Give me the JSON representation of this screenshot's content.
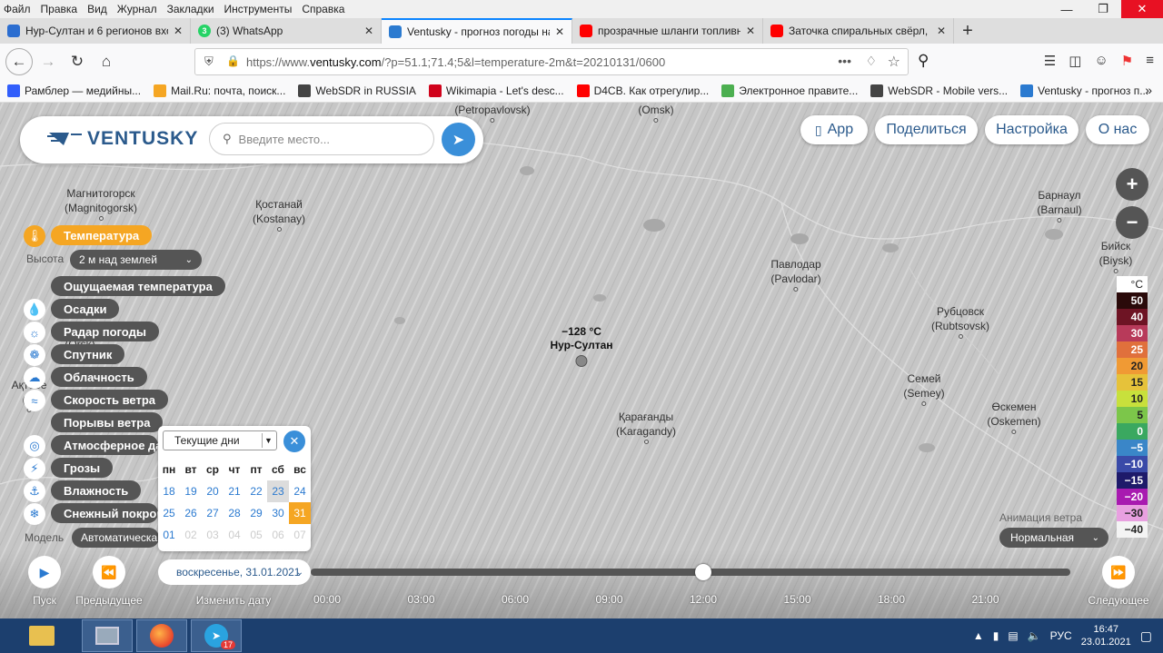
{
  "menu": [
    "Файл",
    "Правка",
    "Вид",
    "Журнал",
    "Закладки",
    "Инструменты",
    "Справка"
  ],
  "tabs": [
    {
      "title": "Нур-Султан и 6 регионов вхо",
      "icon": "at-icon",
      "color": "#2b6dd0"
    },
    {
      "title": "(3) WhatsApp",
      "icon": "whatsapp-icon",
      "color": "#25d366",
      "badge": "3"
    },
    {
      "title": "Ventusky - прогноз погоды на",
      "icon": "ventusky-icon",
      "color": "#2b7ad0"
    },
    {
      "title": "прозрачные шланги топливн",
      "icon": "youtube-icon",
      "color": "#ff0000"
    },
    {
      "title": "Заточка спиральных свёрл, в",
      "icon": "youtube-icon",
      "color": "#ff0000"
    }
  ],
  "url": {
    "prefix": "https://www.",
    "domain": "ventusky.com",
    "path": "/?p=51.1;71.4;5&l=temperature-2m&t=20210131/0600"
  },
  "bookmarks": [
    {
      "title": "Рамблер — медийны...",
      "icon": "rambler-icon",
      "color": "#315efb"
    },
    {
      "title": "Mail.Ru: почта, поиск...",
      "icon": "mailru-icon",
      "color": "#f5a623"
    },
    {
      "title": "WebSDR in RUSSIA",
      "icon": "globe-icon",
      "color": "#444"
    },
    {
      "title": "Wikimapia - Let's desc...",
      "icon": "wikimapia-icon",
      "color": "#d0021b"
    },
    {
      "title": "D4CB. Как отрегулир...",
      "icon": "youtube-icon",
      "color": "#ff0000"
    },
    {
      "title": "Электронное правите...",
      "icon": "egov-icon",
      "color": "#4caf50"
    },
    {
      "title": "WebSDR - Mobile vers...",
      "icon": "globe-icon",
      "color": "#444"
    },
    {
      "title": "Ventusky - прогноз п...",
      "icon": "ventusky-icon",
      "color": "#2b7ad0"
    }
  ],
  "app": {
    "logo": "VENTUSKY",
    "search_placeholder": "Введите место...",
    "top_buttons": [
      "App",
      "Поделиться",
      "Настройка",
      "О нас"
    ]
  },
  "cities": [
    {
      "name": "(Petropavlovsk)"
    },
    {
      "name": "(Omsk)"
    },
    {
      "name": "Магнитогорск",
      "sub": "(Magnitogorsk)"
    },
    {
      "name": "Қостанай",
      "sub": "(Kostanay)"
    },
    {
      "name": "Барнаул",
      "sub": "(Barnaul)"
    },
    {
      "name": "Бийск",
      "sub": "(Biysk)"
    },
    {
      "name": "Павлодар",
      "sub": "(Pavlodar)"
    },
    {
      "name": "Рубцовск",
      "sub": "(Rubtsovsk)"
    },
    {
      "name": "Семей",
      "sub": "(Semey)"
    },
    {
      "name": "Өскемен",
      "sub": "(Oskemen)"
    },
    {
      "name": "Қарағанды",
      "sub": "(Karagandy)"
    },
    {
      "name": "Орск",
      "sub": "(Orsk)"
    },
    {
      "name": "Ақтөбе",
      "sub": "(Al"
    }
  ],
  "selected_point": {
    "temp": "−128 °C",
    "name": "Нур-Султан"
  },
  "layers": {
    "temperature": "Температура",
    "height_label": "Высота",
    "height_value": "2 м над землей",
    "feels": "Ощущаемая температура",
    "precip": "Осадки",
    "radar": "Радар погоды",
    "satellite": "Спутник",
    "clouds": "Облачность",
    "wind": "Скорость ветра",
    "gusts": "Порывы ветра",
    "pressure": "Атмосферное да",
    "storms": "Грозы",
    "humidity": "Влажность",
    "snow": "Снежный покров",
    "model_label": "Модель",
    "model_value": "Автоматическа"
  },
  "calendar": {
    "range": "Текущие дни",
    "weekdays": [
      "пн",
      "вт",
      "ср",
      "чт",
      "пт",
      "сб",
      "вс"
    ],
    "weeks": [
      [
        "18",
        "19",
        "20",
        "21",
        "22",
        "23",
        "24"
      ],
      [
        "25",
        "26",
        "27",
        "28",
        "29",
        "30",
        "31"
      ],
      [
        "01",
        "02",
        "03",
        "04",
        "05",
        "06",
        "07"
      ]
    ],
    "today": "23",
    "selected": "31"
  },
  "legend": {
    "unit": "°C",
    "steps": [
      {
        "v": "50",
        "c": "#2a0a0a",
        "t": "#fff"
      },
      {
        "v": "40",
        "c": "#6e1424",
        "t": "#fff"
      },
      {
        "v": "30",
        "c": "#b83a5a",
        "t": "#fff"
      },
      {
        "v": "25",
        "c": "#e0703c",
        "t": "#fff"
      },
      {
        "v": "20",
        "c": "#f09a34",
        "t": "#222"
      },
      {
        "v": "15",
        "c": "#e6c23a",
        "t": "#222"
      },
      {
        "v": "10",
        "c": "#c8e03c",
        "t": "#222"
      },
      {
        "v": "5",
        "c": "#7cc64a",
        "t": "#222"
      },
      {
        "v": "0",
        "c": "#3aa860",
        "t": "#fff"
      },
      {
        "v": "−5",
        "c": "#3a86c8",
        "t": "#fff"
      },
      {
        "v": "−10",
        "c": "#3a4aa8",
        "t": "#fff"
      },
      {
        "v": "−15",
        "c": "#1e1a6a",
        "t": "#fff"
      },
      {
        "v": "−20",
        "c": "#a81ab0",
        "t": "#fff"
      },
      {
        "v": "−30",
        "c": "#e8a0e0",
        "t": "#222"
      },
      {
        "v": "−40",
        "c": "#f4f4f4",
        "t": "#222"
      }
    ]
  },
  "wind_anim": {
    "label": "Анимация ветра",
    "value": "Нормальная"
  },
  "controls": {
    "play": "Пуск",
    "prev": "Предыдущее",
    "change_date": "Изменить дату",
    "next": "Следующее",
    "date": "воскресенье, 31.01.2021"
  },
  "times": [
    "00:00",
    "03:00",
    "06:00",
    "09:00",
    "12:00",
    "15:00",
    "18:00",
    "21:00"
  ],
  "taskbar": {
    "lang": "РУС",
    "time": "16:47",
    "date": "23.01.2021",
    "telegram_badge": "17"
  }
}
